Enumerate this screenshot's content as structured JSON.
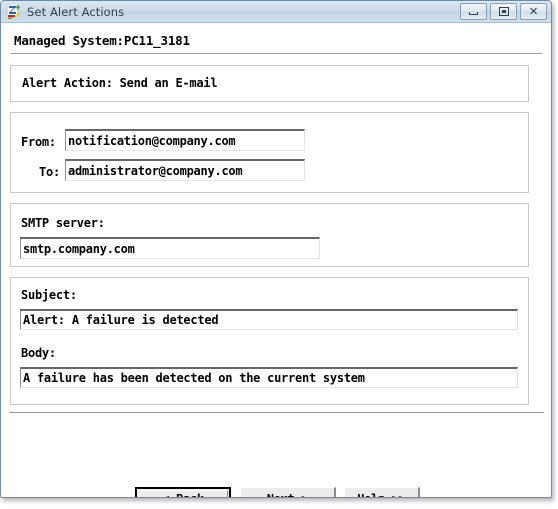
{
  "window": {
    "title": "Set Alert Actions",
    "icon": "alert-actions-icon",
    "controls": {
      "minimize": "minimize-button",
      "restore": "restore-button",
      "close": "close-button"
    }
  },
  "header": {
    "managed_system": "Managed System:PC11_3181"
  },
  "alert_action": {
    "text": "Alert Action: Send an E-mail"
  },
  "address": {
    "from_label": "From:",
    "from_value": "notification@company.com",
    "to_label": "To:",
    "to_value": "administrator@company.com"
  },
  "smtp": {
    "label": "SMTP server:",
    "value": "smtp.company.com"
  },
  "message": {
    "subject_label": "Subject:",
    "subject_value": "Alert: A failure is detected",
    "body_label": "Body:",
    "body_value": "A failure has been detected on the current system"
  },
  "buttons": {
    "back": "< Back",
    "next": "Next >",
    "help": "Help >>"
  },
  "colors": {
    "titlebar_accent": "#c3d4e4",
    "window_border": "#6f8ba4",
    "group_border": "#c9c9c9",
    "field_border_top": "#686868",
    "button_face": "#ececec",
    "separator": "#9a9a9a"
  }
}
